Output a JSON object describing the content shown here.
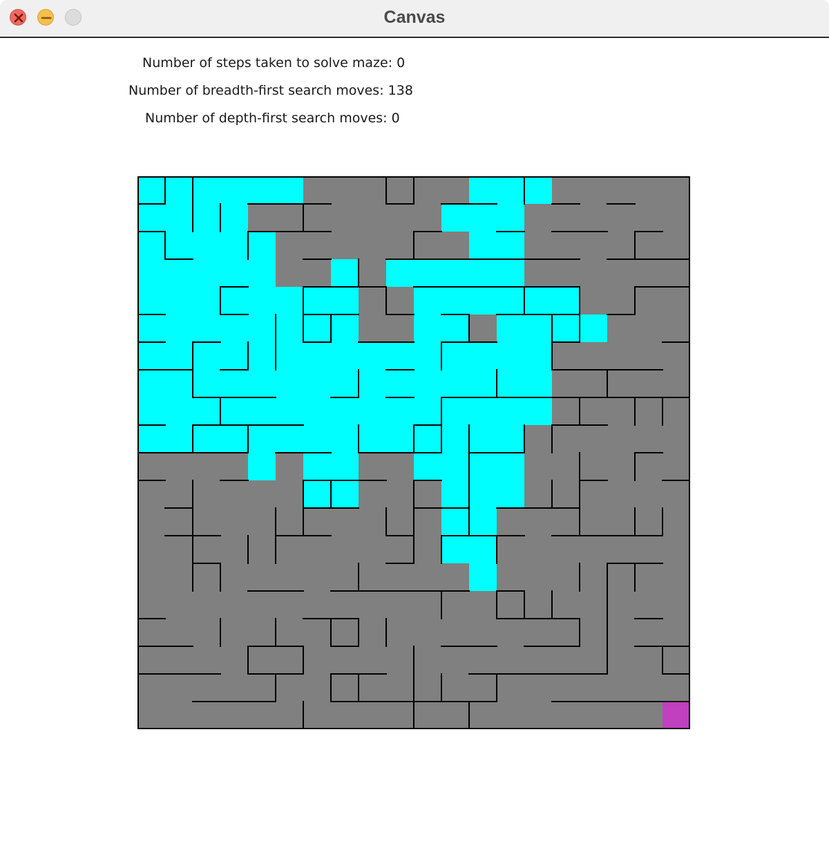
{
  "window": {
    "title": "Canvas",
    "buttons": {
      "close": "close-icon",
      "minimize": "minimize-icon",
      "zoom": "zoom-icon"
    }
  },
  "stats": {
    "steps": "Number of steps taken to solve maze: 0",
    "bfs_moves": "Number of breadth-first search moves: 138",
    "dfs_moves": "Number of depth-first search moves: 0"
  },
  "maze": {
    "rows": 20,
    "cols": 20,
    "colors": {
      "unvisited": "#808080",
      "visited": "#00ffff",
      "goal": "#c040c0",
      "wall": "#000000"
    },
    "goal_cell": [
      19,
      19
    ],
    "visited": [
      [
        0,
        0
      ],
      [
        0,
        1
      ],
      [
        0,
        2
      ],
      [
        0,
        3
      ],
      [
        0,
        4
      ],
      [
        0,
        5
      ],
      [
        0,
        12
      ],
      [
        0,
        13
      ],
      [
        0,
        14
      ],
      [
        1,
        0
      ],
      [
        1,
        1
      ],
      [
        1,
        2
      ],
      [
        1,
        3
      ],
      [
        1,
        11
      ],
      [
        1,
        12
      ],
      [
        1,
        13
      ],
      [
        2,
        0
      ],
      [
        2,
        1
      ],
      [
        2,
        2
      ],
      [
        2,
        3
      ],
      [
        2,
        4
      ],
      [
        2,
        12
      ],
      [
        2,
        13
      ],
      [
        3,
        0
      ],
      [
        3,
        1
      ],
      [
        3,
        2
      ],
      [
        3,
        3
      ],
      [
        3,
        4
      ],
      [
        3,
        7
      ],
      [
        3,
        9
      ],
      [
        3,
        10
      ],
      [
        3,
        11
      ],
      [
        3,
        12
      ],
      [
        3,
        13
      ],
      [
        4,
        0
      ],
      [
        4,
        1
      ],
      [
        4,
        2
      ],
      [
        4,
        3
      ],
      [
        4,
        4
      ],
      [
        4,
        5
      ],
      [
        4,
        6
      ],
      [
        4,
        7
      ],
      [
        4,
        10
      ],
      [
        4,
        11
      ],
      [
        4,
        12
      ],
      [
        4,
        13
      ],
      [
        4,
        14
      ],
      [
        4,
        15
      ],
      [
        5,
        0
      ],
      [
        5,
        1
      ],
      [
        5,
        2
      ],
      [
        5,
        3
      ],
      [
        5,
        4
      ],
      [
        5,
        5
      ],
      [
        5,
        6
      ],
      [
        5,
        7
      ],
      [
        5,
        10
      ],
      [
        5,
        11
      ],
      [
        5,
        13
      ],
      [
        5,
        14
      ],
      [
        5,
        15
      ],
      [
        5,
        16
      ],
      [
        6,
        0
      ],
      [
        6,
        1
      ],
      [
        6,
        2
      ],
      [
        6,
        3
      ],
      [
        6,
        4
      ],
      [
        6,
        5
      ],
      [
        6,
        6
      ],
      [
        6,
        7
      ],
      [
        6,
        8
      ],
      [
        6,
        9
      ],
      [
        6,
        10
      ],
      [
        6,
        11
      ],
      [
        6,
        12
      ],
      [
        6,
        13
      ],
      [
        6,
        14
      ],
      [
        7,
        0
      ],
      [
        7,
        1
      ],
      [
        7,
        2
      ],
      [
        7,
        3
      ],
      [
        7,
        4
      ],
      [
        7,
        5
      ],
      [
        7,
        6
      ],
      [
        7,
        7
      ],
      [
        7,
        8
      ],
      [
        7,
        9
      ],
      [
        7,
        10
      ],
      [
        7,
        11
      ],
      [
        7,
        12
      ],
      [
        7,
        13
      ],
      [
        7,
        14
      ],
      [
        8,
        0
      ],
      [
        8,
        1
      ],
      [
        8,
        2
      ],
      [
        8,
        3
      ],
      [
        8,
        4
      ],
      [
        8,
        5
      ],
      [
        8,
        6
      ],
      [
        8,
        7
      ],
      [
        8,
        8
      ],
      [
        8,
        9
      ],
      [
        8,
        10
      ],
      [
        8,
        11
      ],
      [
        8,
        12
      ],
      [
        8,
        13
      ],
      [
        8,
        14
      ],
      [
        9,
        0
      ],
      [
        9,
        1
      ],
      [
        9,
        2
      ],
      [
        9,
        3
      ],
      [
        9,
        4
      ],
      [
        9,
        5
      ],
      [
        9,
        6
      ],
      [
        9,
        7
      ],
      [
        9,
        8
      ],
      [
        9,
        9
      ],
      [
        9,
        10
      ],
      [
        9,
        11
      ],
      [
        9,
        12
      ],
      [
        9,
        13
      ],
      [
        10,
        4
      ],
      [
        10,
        6
      ],
      [
        10,
        7
      ],
      [
        10,
        10
      ],
      [
        10,
        11
      ],
      [
        10,
        12
      ],
      [
        10,
        13
      ],
      [
        11,
        6
      ],
      [
        11,
        7
      ],
      [
        11,
        11
      ],
      [
        11,
        12
      ],
      [
        11,
        13
      ],
      [
        12,
        11
      ],
      [
        12,
        12
      ],
      [
        13,
        11
      ],
      [
        13,
        12
      ],
      [
        14,
        12
      ]
    ],
    "walls_h": [
      [
        1,
        1,
        0,
        1
      ],
      [
        1,
        4,
        7,
        5
      ],
      [
        1,
        9,
        10,
        9
      ],
      [
        1,
        11,
        12,
        11
      ],
      [
        1,
        12,
        13,
        12
      ],
      [
        1,
        15,
        16,
        15
      ],
      [
        1,
        17,
        18,
        17
      ],
      [
        2,
        0,
        1,
        0
      ],
      [
        2,
        4,
        7,
        4
      ],
      [
        2,
        10,
        11,
        10
      ],
      [
        2,
        13,
        14,
        13
      ],
      [
        2,
        15,
        17,
        15
      ],
      [
        2,
        18,
        19,
        18
      ],
      [
        3,
        1,
        2,
        1
      ],
      [
        3,
        6,
        7,
        6
      ],
      [
        3,
        9,
        14,
        9
      ],
      [
        3,
        14,
        15,
        14
      ],
      [
        3,
        15,
        16,
        15
      ],
      [
        3,
        17,
        20,
        17
      ],
      [
        4,
        3,
        4,
        3
      ],
      [
        4,
        6,
        8,
        6
      ],
      [
        4,
        8,
        9,
        8
      ],
      [
        4,
        10,
        11,
        10
      ],
      [
        4,
        11,
        12,
        11
      ],
      [
        4,
        12,
        16,
        12
      ],
      [
        4,
        18,
        20,
        18
      ],
      [
        5,
        0,
        1,
        0
      ],
      [
        5,
        3,
        4,
        3
      ],
      [
        5,
        6,
        8,
        6
      ],
      [
        5,
        9,
        10,
        9
      ],
      [
        5,
        11,
        12,
        11
      ],
      [
        5,
        13,
        16,
        13
      ],
      [
        5,
        17,
        18,
        17
      ],
      [
        6,
        0,
        1,
        0
      ],
      [
        6,
        2,
        3,
        2
      ],
      [
        6,
        6,
        7,
        6
      ],
      [
        6,
        8,
        10,
        8
      ],
      [
        6,
        11,
        13,
        11
      ],
      [
        6,
        15,
        16,
        15
      ],
      [
        6,
        19,
        20,
        19
      ],
      [
        7,
        0,
        2,
        0
      ],
      [
        7,
        3,
        4,
        3
      ],
      [
        7,
        9,
        10,
        9
      ],
      [
        7,
        15,
        19,
        15
      ],
      [
        8,
        2,
        5,
        2
      ],
      [
        8,
        7,
        8,
        7
      ],
      [
        8,
        9,
        10,
        9
      ],
      [
        8,
        11,
        14,
        11
      ],
      [
        8,
        14,
        20,
        14
      ],
      [
        9,
        0,
        1,
        0
      ],
      [
        9,
        2,
        6,
        2
      ],
      [
        9,
        10,
        11,
        10
      ],
      [
        9,
        15,
        17,
        15
      ],
      [
        10,
        0,
        4,
        0
      ],
      [
        10,
        5,
        7,
        5
      ],
      [
        10,
        8,
        9,
        8
      ],
      [
        10,
        9,
        11,
        9
      ],
      [
        10,
        12,
        14,
        12
      ],
      [
        10,
        18,
        19,
        18
      ],
      [
        11,
        0,
        1,
        0
      ],
      [
        11,
        3,
        4,
        3
      ],
      [
        11,
        6,
        8,
        6
      ],
      [
        11,
        8,
        9,
        8
      ],
      [
        11,
        10,
        11,
        10
      ],
      [
        11,
        16,
        17,
        16
      ],
      [
        11,
        19,
        20,
        19
      ],
      [
        12,
        1,
        2,
        1
      ],
      [
        12,
        6,
        7,
        6
      ],
      [
        12,
        7,
        8,
        7
      ],
      [
        12,
        10,
        12,
        10
      ],
      [
        12,
        13,
        16,
        13
      ],
      [
        13,
        1,
        3,
        1
      ],
      [
        13,
        5,
        7,
        5
      ],
      [
        13,
        9,
        10,
        9
      ],
      [
        13,
        11,
        14,
        11
      ],
      [
        13,
        15,
        19,
        15
      ],
      [
        14,
        2,
        3,
        2
      ],
      [
        14,
        9,
        10,
        9
      ],
      [
        14,
        17,
        19,
        17
      ],
      [
        15,
        4,
        6,
        4
      ],
      [
        15,
        7,
        9,
        7
      ],
      [
        15,
        9,
        12,
        9
      ],
      [
        15,
        13,
        14,
        13
      ],
      [
        16,
        0,
        1,
        0
      ],
      [
        16,
        6,
        8,
        6
      ],
      [
        16,
        13,
        16,
        13
      ],
      [
        16,
        18,
        19,
        18
      ],
      [
        17,
        0,
        2,
        0
      ],
      [
        17,
        4,
        6,
        4
      ],
      [
        17,
        7,
        8,
        7
      ],
      [
        17,
        11,
        13,
        11
      ],
      [
        17,
        14,
        16,
        14
      ],
      [
        17,
        18,
        20,
        18
      ],
      [
        18,
        0,
        3,
        0
      ],
      [
        18,
        4,
        6,
        4
      ],
      [
        18,
        7,
        9,
        7
      ],
      [
        18,
        12,
        15,
        12
      ],
      [
        18,
        15,
        17,
        15
      ],
      [
        18,
        19,
        20,
        19
      ],
      [
        19,
        2,
        5,
        2
      ],
      [
        19,
        7,
        8,
        7
      ],
      [
        19,
        8,
        13,
        8
      ],
      [
        19,
        15,
        17,
        15
      ],
      [
        19,
        17,
        20,
        17
      ],
      [
        20,
        0,
        20,
        0
      ]
    ],
    "walls_v": [
      [
        1,
        0,
        1,
        1
      ],
      [
        1,
        2,
        3,
        1
      ],
      [
        2,
        0,
        2,
        1
      ],
      [
        2,
        6,
        8,
        1
      ],
      [
        2,
        9,
        10,
        1
      ],
      [
        2,
        11,
        15,
        1
      ],
      [
        3,
        1,
        2,
        3
      ],
      [
        3,
        4,
        5,
        3
      ],
      [
        3,
        8,
        9,
        3
      ],
      [
        3,
        14,
        15,
        3
      ],
      [
        3,
        16,
        17,
        3
      ],
      [
        3,
        20,
        20,
        3
      ],
      [
        4,
        2,
        3,
        4
      ],
      [
        4,
        6,
        7,
        4
      ],
      [
        4,
        9,
        10,
        4
      ],
      [
        4,
        13,
        14,
        4
      ],
      [
        4,
        17,
        18,
        4
      ],
      [
        5,
        5,
        7,
        5
      ],
      [
        5,
        12,
        14,
        5
      ],
      [
        5,
        16,
        17,
        5
      ],
      [
        5,
        18,
        19,
        5
      ],
      [
        6,
        1,
        2,
        6
      ],
      [
        6,
        4,
        6,
        6
      ],
      [
        6,
        11,
        13,
        6
      ],
      [
        6,
        17,
        18,
        6
      ],
      [
        6,
        19,
        20,
        6
      ],
      [
        7,
        5,
        6,
        7
      ],
      [
        7,
        11,
        12,
        7
      ],
      [
        7,
        16,
        17,
        7
      ],
      [
        7,
        18,
        19,
        7
      ],
      [
        7,
        20,
        20,
        7
      ],
      [
        8,
        3,
        4,
        8
      ],
      [
        8,
        7,
        8,
        8
      ],
      [
        8,
        9,
        10,
        8
      ],
      [
        8,
        14,
        15,
        8
      ],
      [
        8,
        16,
        17,
        8
      ],
      [
        8,
        18,
        19,
        8
      ],
      [
        9,
        0,
        1,
        9
      ],
      [
        9,
        4,
        5,
        9
      ],
      [
        9,
        12,
        13,
        9
      ],
      [
        9,
        16,
        17,
        9
      ],
      [
        10,
        0,
        1,
        10
      ],
      [
        10,
        2,
        3,
        10
      ],
      [
        10,
        9,
        10,
        10
      ],
      [
        10,
        11,
        14,
        10
      ],
      [
        10,
        17,
        18,
        10
      ],
      [
        10,
        18,
        20,
        10
      ],
      [
        11,
        6,
        7,
        11
      ],
      [
        11,
        8,
        10,
        11
      ],
      [
        11,
        13,
        14,
        11
      ],
      [
        11,
        15,
        16,
        11
      ],
      [
        11,
        18,
        19,
        11
      ],
      [
        12,
        5,
        6,
        12
      ],
      [
        12,
        9,
        13,
        12
      ],
      [
        12,
        19,
        20,
        12
      ],
      [
        13,
        7,
        8,
        13
      ],
      [
        13,
        13,
        14,
        13
      ],
      [
        13,
        15,
        16,
        13
      ],
      [
        13,
        18,
        19,
        13
      ],
      [
        14,
        0,
        1,
        14
      ],
      [
        14,
        4,
        5,
        14
      ],
      [
        14,
        9,
        10,
        14
      ],
      [
        14,
        15,
        16,
        14
      ],
      [
        15,
        5,
        7,
        15
      ],
      [
        15,
        9,
        10,
        15
      ],
      [
        15,
        11,
        12,
        15
      ],
      [
        15,
        15,
        16,
        15
      ],
      [
        16,
        4,
        5,
        16
      ],
      [
        16,
        5,
        6,
        16
      ],
      [
        16,
        8,
        9,
        16
      ],
      [
        16,
        10,
        13,
        16
      ],
      [
        16,
        14,
        15,
        16
      ],
      [
        16,
        16,
        17,
        16
      ],
      [
        17,
        7,
        8,
        17
      ],
      [
        17,
        14,
        15,
        17
      ],
      [
        17,
        15,
        18,
        17
      ],
      [
        18,
        2,
        3,
        18
      ],
      [
        18,
        4,
        5,
        18
      ],
      [
        18,
        8,
        9,
        18
      ],
      [
        18,
        10,
        11,
        18
      ],
      [
        18,
        12,
        13,
        18
      ],
      [
        18,
        14,
        15,
        18
      ],
      [
        19,
        8,
        9,
        19
      ],
      [
        19,
        12,
        13,
        19
      ],
      [
        19,
        17,
        18,
        19
      ],
      [
        20,
        0,
        20,
        20
      ]
    ]
  }
}
